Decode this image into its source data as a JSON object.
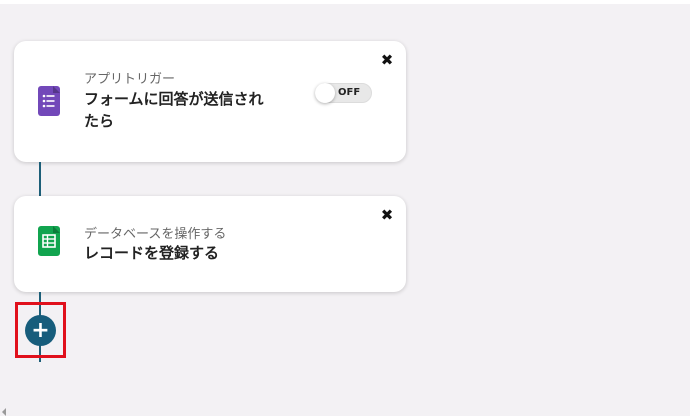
{
  "trigger_card": {
    "subtitle": "アプリトリガー",
    "title": "フォームに回答が送信されたら",
    "app_icon": "google-forms-icon",
    "toggle_label": "OFF",
    "close_icon": "✖"
  },
  "action_card": {
    "subtitle": "データベースを操作する",
    "title": "レコードを登録する",
    "app_icon": "google-sheets-icon",
    "close_icon": "✖"
  },
  "add_button": {
    "label": "+"
  },
  "colors": {
    "canvas": "#f3f1f4",
    "connector": "#1d5f78",
    "add_button": "#175d7c",
    "highlight": "#e0101c",
    "forms_purple": "#7248b9",
    "sheets_green": "#11a44f"
  }
}
